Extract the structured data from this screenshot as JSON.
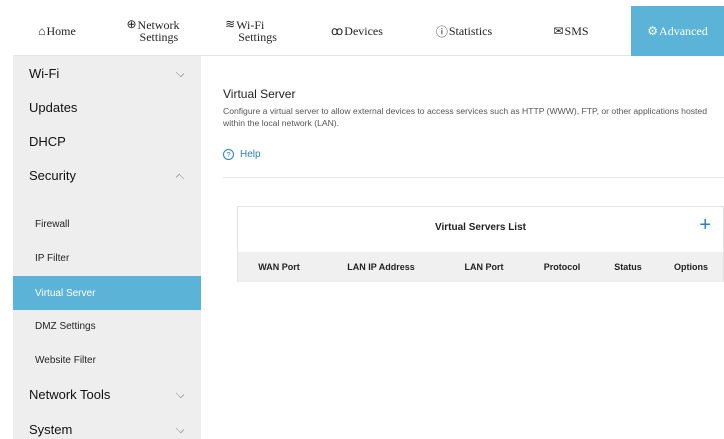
{
  "topnav": {
    "items": [
      {
        "icon": "⌂",
        "line1": "Home",
        "line2": ""
      },
      {
        "icon": "⊕",
        "line1": "Network",
        "line2": "Settings"
      },
      {
        "icon": "≋",
        "line1": "Wi-Fi",
        "line2": "Settings"
      },
      {
        "icon": "ꝏ",
        "line1": "Devices",
        "line2": ""
      },
      {
        "icon": "ⓘ",
        "line1": "Statistics",
        "line2": ""
      },
      {
        "icon": "✉",
        "line1": "SMS",
        "line2": ""
      },
      {
        "icon": "⚙",
        "line1": "Advanced",
        "line2": ""
      }
    ],
    "active": "Advanced",
    "active_color": "#5bb3d8"
  },
  "sidebar": {
    "items": [
      {
        "label": "Wi-Fi"
      },
      {
        "label": "Updates"
      },
      {
        "label": "DHCP"
      },
      {
        "label": "Security"
      },
      {
        "label": "Firewall"
      },
      {
        "label": "IP Filter"
      },
      {
        "label": "Virtual Server"
      },
      {
        "label": "DMZ Settings"
      },
      {
        "label": "Website Filter"
      },
      {
        "label": "Network Tools"
      },
      {
        "label": "System"
      }
    ]
  },
  "main": {
    "title": "Virtual Server",
    "description": "Configure a virtual server to allow external devices to access services such as HTTP (WWW), FTP, or other applications hosted within the local network (LAN).",
    "help_label": "Help",
    "list": {
      "title": "Virtual Servers List",
      "add_label": "+",
      "columns": [
        "WAN Port",
        "LAN IP Address",
        "LAN Port",
        "Protocol",
        "Status",
        "Options"
      ]
    }
  }
}
